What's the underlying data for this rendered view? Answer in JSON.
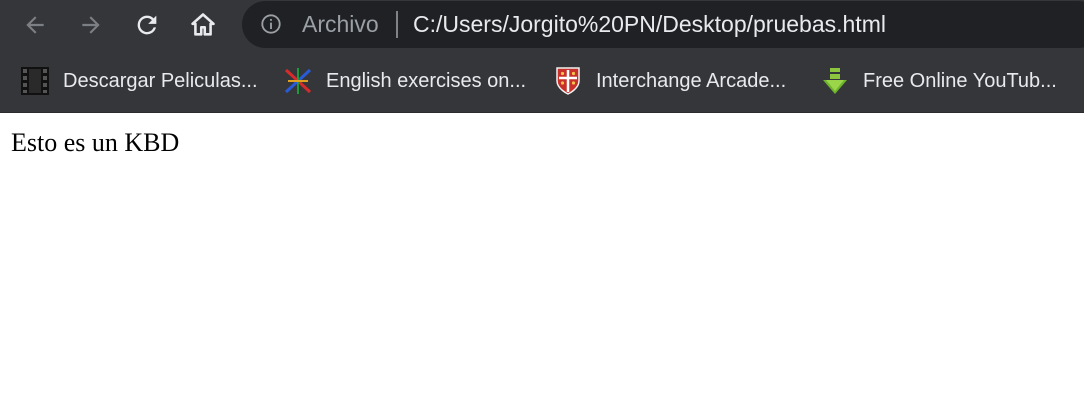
{
  "toolbar": {
    "back_icon": "arrow-left-icon",
    "forward_icon": "arrow-right-icon",
    "reload_icon": "reload-icon",
    "home_icon": "home-icon",
    "background": "#35363a"
  },
  "omnibox": {
    "security_icon": "info-icon",
    "label": "Archivo",
    "url": "C:/Users/Jorgito%20PN/Desktop/pruebas.html",
    "background": "#202124"
  },
  "bookmarks": [
    {
      "label": "Descargar Peliculas...",
      "icon": "film-icon"
    },
    {
      "label": "English exercises on...",
      "icon": "english-exercises-icon"
    },
    {
      "label": "Interchange Arcade...",
      "icon": "cambridge-shield-icon"
    },
    {
      "label": "Free Online YouTub...",
      "icon": "download-arrow-icon"
    }
  ],
  "page": {
    "text": "Esto es un KBD"
  }
}
